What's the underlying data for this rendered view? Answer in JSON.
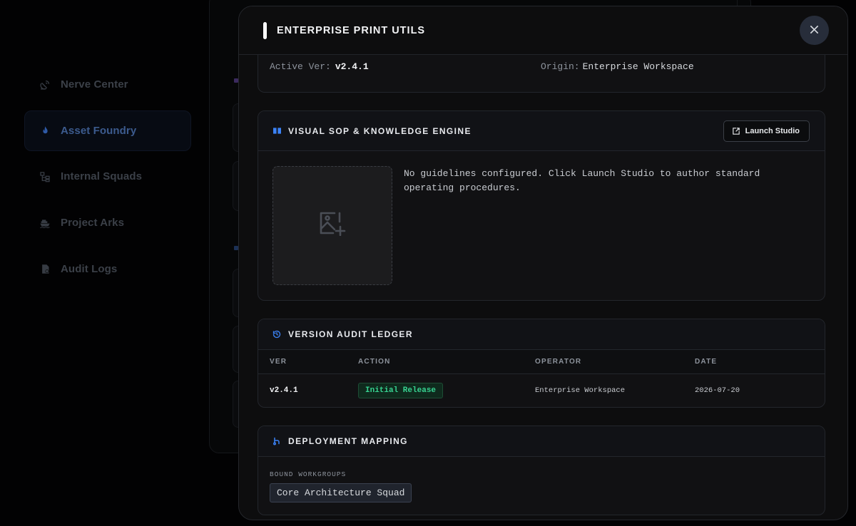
{
  "sidebar": {
    "items": [
      {
        "label": "Nerve Center",
        "icon": "satellite-dish-icon",
        "active": false
      },
      {
        "label": "Asset Foundry",
        "icon": "flame-icon",
        "active": true
      },
      {
        "label": "Internal Squads",
        "icon": "sitemap-icon",
        "active": false
      },
      {
        "label": "Project Arks",
        "icon": "ship-icon",
        "active": false
      },
      {
        "label": "Audit Logs",
        "icon": "file-log-icon",
        "active": false
      }
    ]
  },
  "modal": {
    "title": "ENTERPRISE PRINT UTILS",
    "close_icon": "close-icon",
    "info": {
      "active_ver_label": "Active Ver:",
      "active_ver_value": "v2.4.1",
      "origin_label": "Origin:",
      "origin_value": "Enterprise Workspace"
    },
    "sop": {
      "title": "VISUAL SOP & KNOWLEDGE ENGINE",
      "icon": "book-icon",
      "launch_label": "Launch Studio",
      "launch_icon": "external-edit-icon",
      "dropzone_icon": "image-add-icon",
      "empty_text": "No guidelines configured. Click Launch Studio to author standard operating procedures."
    },
    "ledger": {
      "title": "VERSION AUDIT LEDGER",
      "icon": "history-icon",
      "columns": [
        "VER",
        "ACTION",
        "OPERATOR",
        "DATE"
      ],
      "rows": [
        {
          "ver": "v2.4.1",
          "action": "Initial Release",
          "operator": "Enterprise Workspace",
          "date": "2026-07-20"
        }
      ]
    },
    "deployment": {
      "title": "DEPLOYMENT MAPPING",
      "icon": "branch-icon",
      "bound_label": "BOUND WORKGROUPS",
      "workgroups": [
        "Core Architecture Squad"
      ]
    }
  },
  "colors": {
    "accent": "#3b82f6",
    "success": "#37d391",
    "background": "#020203",
    "modal": "#0d0d0e"
  }
}
